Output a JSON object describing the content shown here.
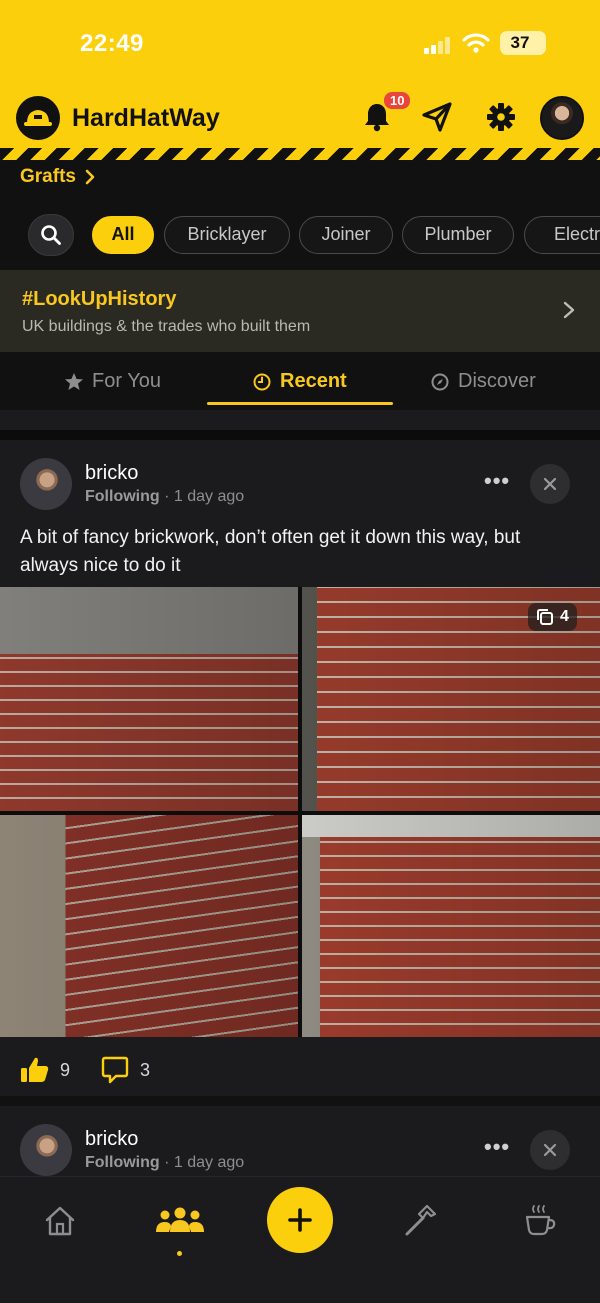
{
  "status_bar": {
    "time": "22:49",
    "battery": "37"
  },
  "header": {
    "app_title": "HardHatWay",
    "notification_count": "10",
    "accent_color": "#fccf0c"
  },
  "grafts": {
    "label": "Grafts"
  },
  "chips": {
    "items": [
      "All",
      "Bricklayer",
      "Joiner",
      "Plumber",
      "Electri"
    ],
    "selected": "All"
  },
  "banner": {
    "title": "#LookUpHistory",
    "subtitle": "UK buildings & the trades who built them"
  },
  "tabs": {
    "items": [
      {
        "label": "For You",
        "icon": "star-icon"
      },
      {
        "label": "Recent",
        "icon": "clock-icon"
      },
      {
        "label": "Discover",
        "icon": "compass-icon"
      }
    ],
    "active": "Recent"
  },
  "posts": [
    {
      "username": "bricko",
      "follow_status": "Following",
      "time": "1 day ago",
      "text": "A bit of fancy brickwork, don’t often get it down this way, but always nice to do it",
      "image_count": "4",
      "likes": "9",
      "comments": "3"
    },
    {
      "username": "bricko",
      "follow_status": "Following",
      "time": "1 day ago"
    }
  ],
  "bottom_nav": {
    "items": [
      "home-icon",
      "community-icon",
      "add-icon",
      "hammer-icon",
      "coffee-icon"
    ],
    "active": "community-icon"
  }
}
